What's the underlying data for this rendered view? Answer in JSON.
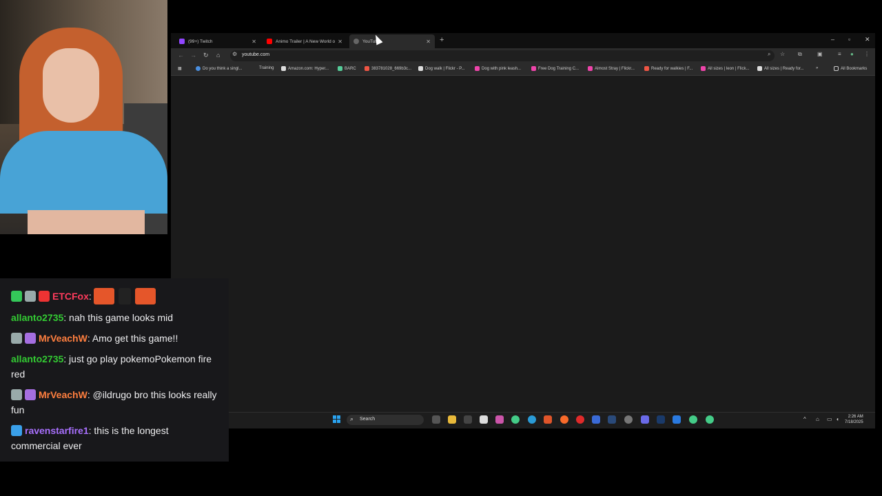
{
  "browser": {
    "tabs": [
      {
        "title": "(99+) Twitch"
      },
      {
        "title": "Animo Trailer | A New World o"
      },
      {
        "title": "YouTube"
      }
    ],
    "url": "youtube.com",
    "bookmarks": [
      "Do you think a singl...",
      "Training",
      "Amazon.com: Hyper...",
      "BARC",
      "383781028_669b3c...",
      "Dog walk | Flickr - P...",
      "Dog with pink leash...",
      "Free Dog Training C...",
      "Almost Stray | Flickr...",
      "Ready for walkies | F...",
      "All sizes | leon | Flick...",
      "All sizes | Ready for..."
    ],
    "all_bookmarks": "All Bookmarks"
  },
  "taskbar": {
    "search": "Search",
    "time": "2:26 AM",
    "date": "7/18/2025"
  },
  "chat": {
    "messages": [
      {
        "user": "ETCFox",
        "text": "",
        "color": "#ff3b5c"
      },
      {
        "user": "allanto2735",
        "text": "nah this game looks mid",
        "color": "#33cc33"
      },
      {
        "user": "MrVeachW",
        "text": "Amo get this game!!",
        "color": "#ff7f3f"
      },
      {
        "user": "allanto2735",
        "text": "just go play pokemoPokemon fire red",
        "color": "#33cc33"
      },
      {
        "user": "MrVeachW",
        "text": "@ildrugo bro this looks really fun",
        "color": "#ff7f3f"
      },
      {
        "user": "ravenstarfire1",
        "text": "this is the longest commercial ever",
        "color": "#a970ff"
      }
    ]
  }
}
